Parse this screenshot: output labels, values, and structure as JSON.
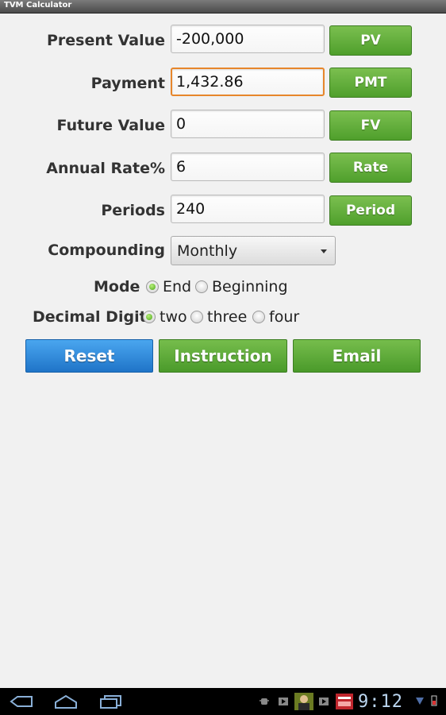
{
  "app": {
    "title": "TVM Calculator"
  },
  "rows": [
    {
      "label": "Present Value",
      "value": "-200,000",
      "button": "PV"
    },
    {
      "label": "Payment",
      "value": "1,432.86",
      "button": "PMT"
    },
    {
      "label": "Future Value",
      "value": "0",
      "button": "FV"
    },
    {
      "label": "Annual Rate%",
      "value": "6",
      "button": "Rate"
    },
    {
      "label": "Periods",
      "value": "240",
      "button": "Period"
    }
  ],
  "compounding": {
    "label": "Compounding",
    "selected": "Monthly"
  },
  "mode": {
    "label": "Mode",
    "options": [
      "End",
      "Beginning"
    ],
    "selected": "End"
  },
  "decimal": {
    "label": "Decimal Digit",
    "options": [
      "two",
      "three",
      "four"
    ],
    "selected": "two"
  },
  "actions": {
    "reset": "Reset",
    "instruction": "Instruction",
    "email": "Email"
  },
  "status_bar": {
    "time": "9:12"
  },
  "colors": {
    "accent_green": "#5aa834",
    "accent_blue": "#2b85d8",
    "focus_orange": "#e7862b"
  },
  "icons": [
    "back-icon",
    "home-icon",
    "recent-apps-icon",
    "android-debug-icon",
    "media-icon",
    "contact-photo-icon",
    "media-icon",
    "news-app-icon",
    "battery-icon",
    "signal-icon"
  ]
}
